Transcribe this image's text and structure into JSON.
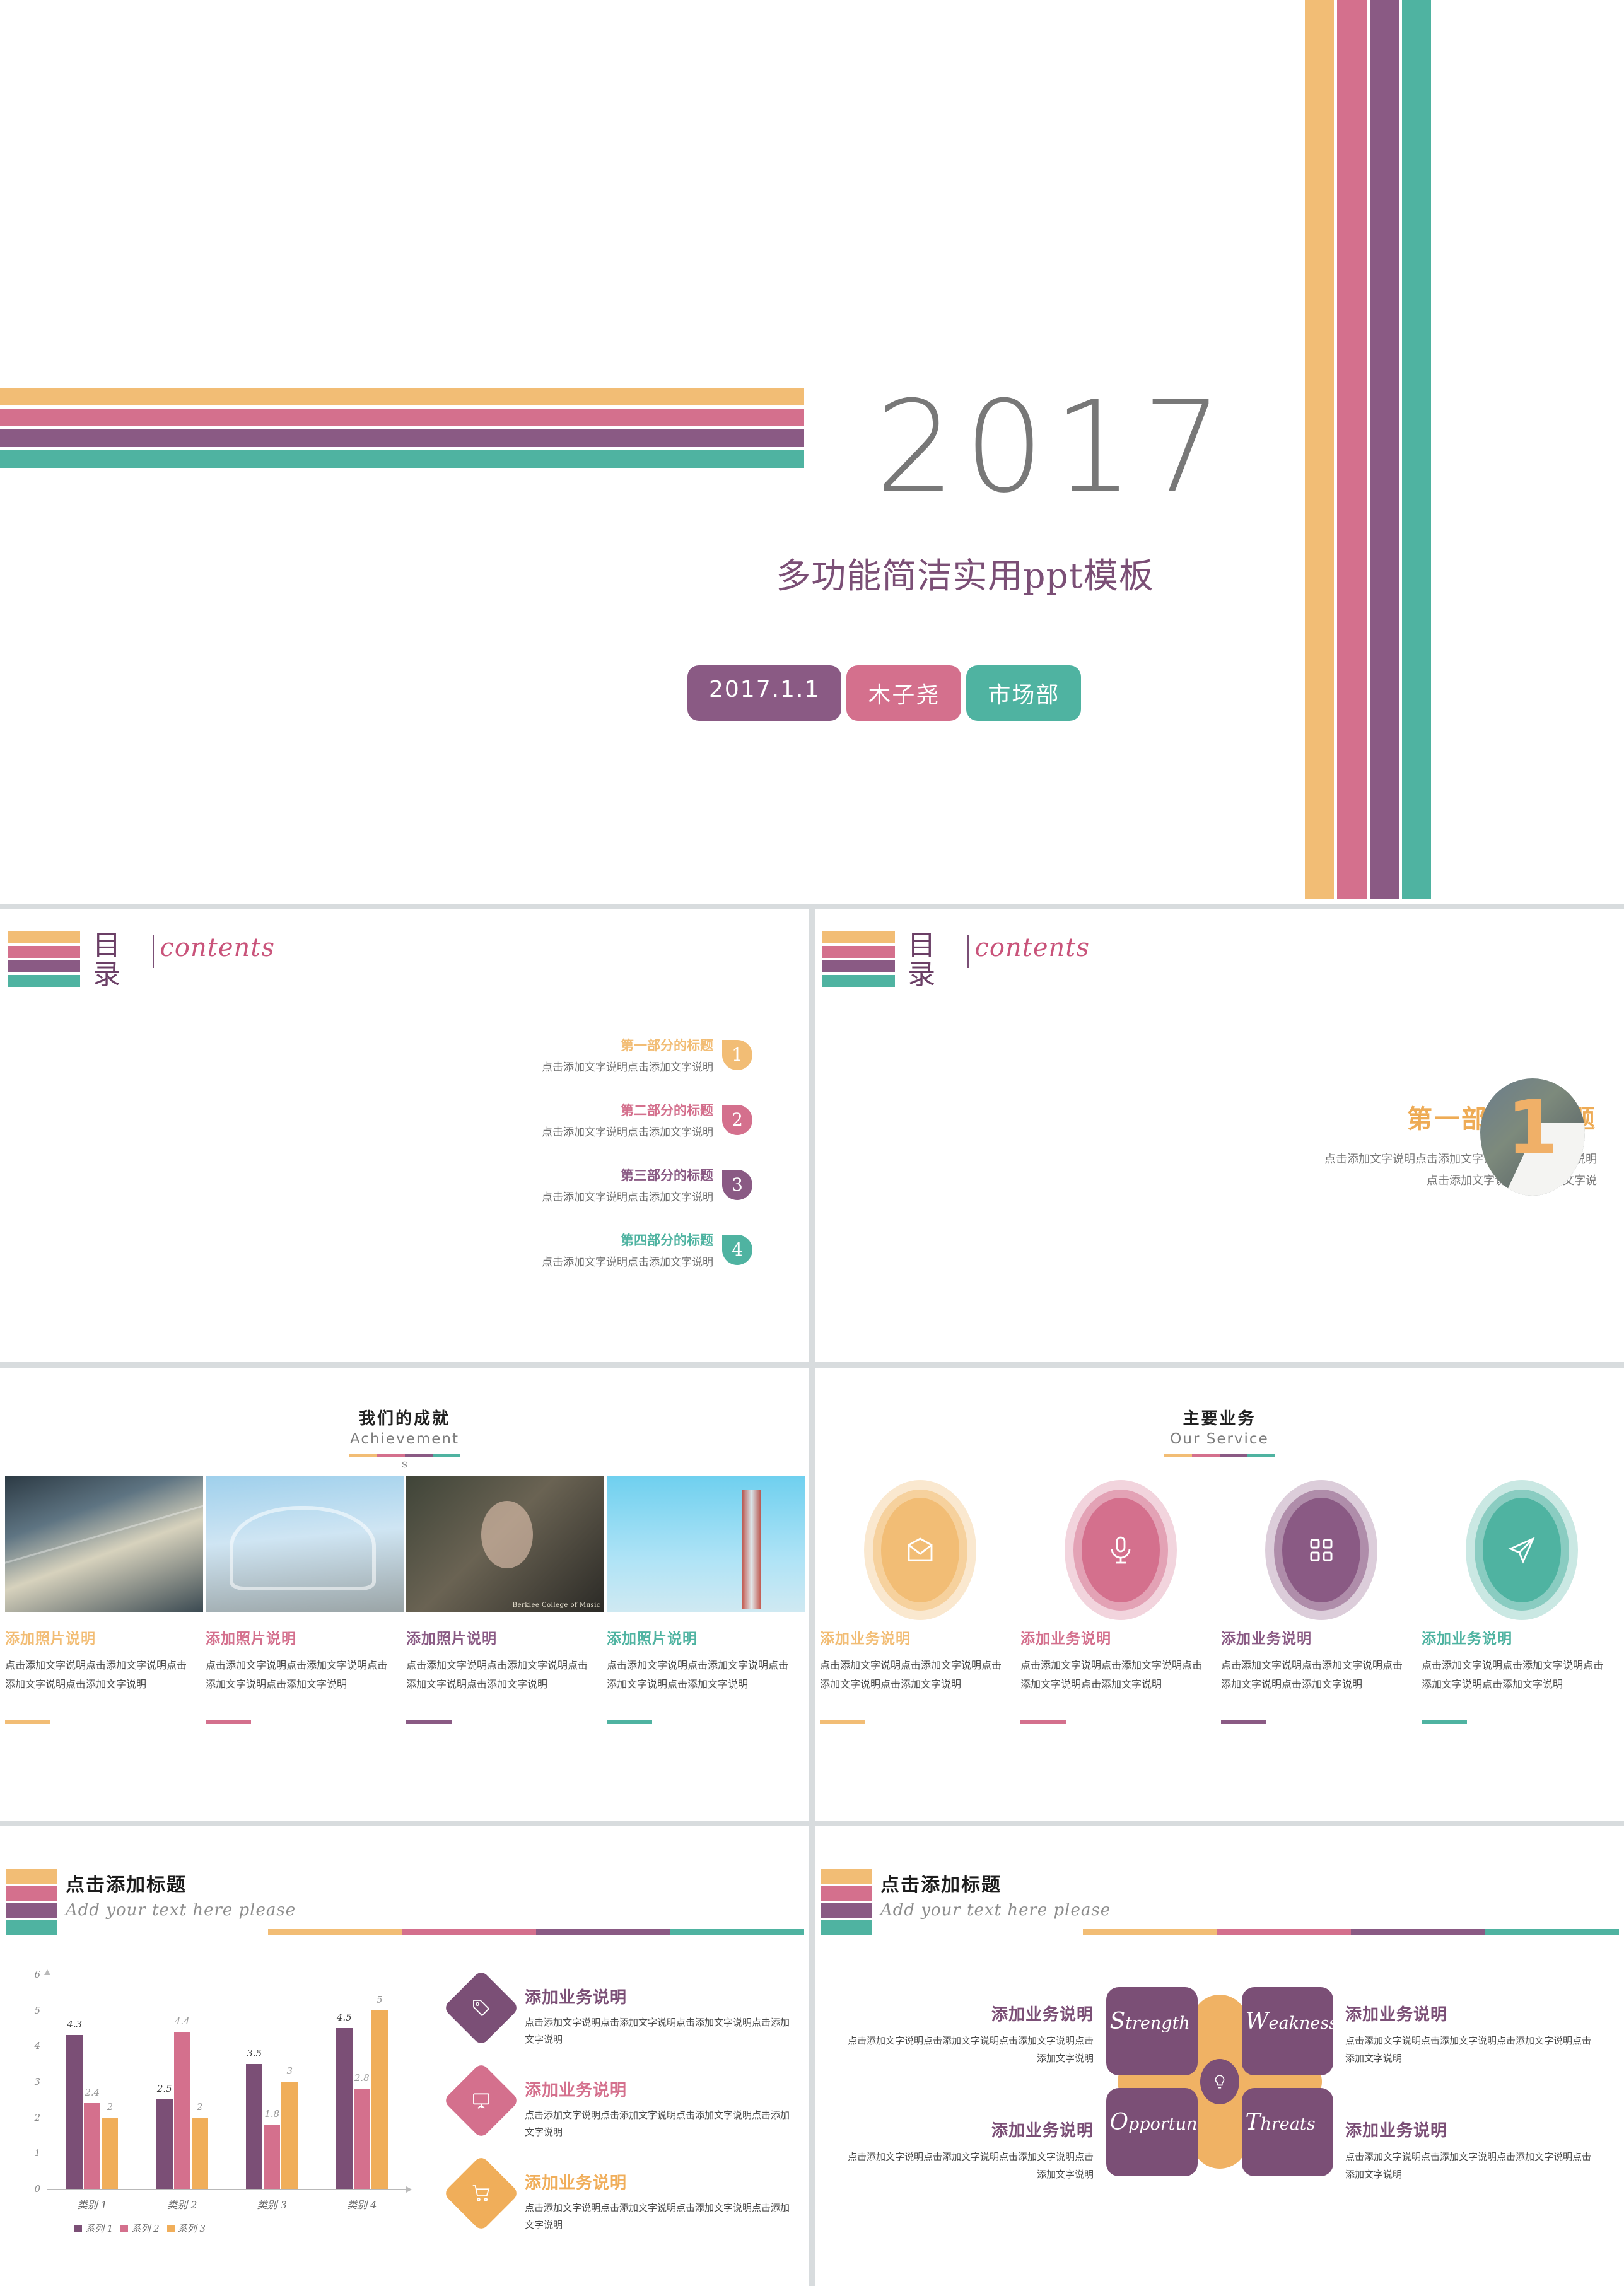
{
  "palette": {
    "orange": "#F2BD75",
    "pink": "#D4708D",
    "purple": "#8A5A84",
    "teal": "#4FB3A1",
    "orange_dark": "#EDA94E",
    "pink_dark": "#CC6384",
    "purple_dark": "#7B4F76",
    "teal_dark": "#45A694",
    "gap": "#D8DCDE"
  },
  "slide1": {
    "year": "2017",
    "title": "多功能简洁实用ppt模板",
    "tags": [
      {
        "label": "2017.1.1",
        "color": "#8A5A84"
      },
      {
        "label": "木子尧",
        "color": "#D4708D"
      },
      {
        "label": "市场部",
        "color": "#4FB3A1"
      }
    ]
  },
  "slide2": {
    "head_zh": "目录",
    "head_en": "contents",
    "items": [
      {
        "num": "1",
        "title": "第一部分的标题",
        "desc": "点击添加文字说明点击添加文字说明",
        "color": "#F2BD75"
      },
      {
        "num": "2",
        "title": "第二部分的标题",
        "desc": "点击添加文字说明点击添加文字说明",
        "color": "#D4708D"
      },
      {
        "num": "3",
        "title": "第三部分的标题",
        "desc": "点击添加文字说明点击添加文字说明",
        "color": "#8A5A84"
      },
      {
        "num": "4",
        "title": "第四部分的标题",
        "desc": "点击添加文字说明点击添加文字说明",
        "color": "#4FB3A1"
      }
    ]
  },
  "slide3": {
    "head_zh": "目录",
    "head_en": "contents",
    "section_title": "第一部分的标题",
    "section_line1": "点击添加文字说明点击添加文字说明点击添加文字说明",
    "section_line2": "点击添加文字说明点击添加文字说",
    "badge_number": "1"
  },
  "slide4": {
    "head_zh": "我们的成就",
    "head_en": "Achievement",
    "head_tail": "s",
    "photo_caption": "Berklee College of Music",
    "columns": [
      {
        "title": "添加照片说明",
        "body": "点击添加文字说明点击添加文字说明点击添加文字说明点击添加文字说明",
        "color": "#F2BD75"
      },
      {
        "title": "添加照片说明",
        "body": "点击添加文字说明点击添加文字说明点击添加文字说明点击添加文字说明",
        "color": "#D4708D"
      },
      {
        "title": "添加照片说明",
        "body": "点击添加文字说明点击添加文字说明点击添加文字说明点击添加文字说明",
        "color": "#8A5A84"
      },
      {
        "title": "添加照片说明",
        "body": "点击添加文字说明点击添加文字说明点击添加文字说明点击添加文字说明",
        "color": "#4FB3A1"
      }
    ]
  },
  "slide5": {
    "head_zh": "主要业务",
    "head_en": "Our Service",
    "columns": [
      {
        "icon": "envelope-icon",
        "title": "添加业务说明",
        "body": "点击添加文字说明点击添加文字说明点击添加文字说明点击添加文字说明",
        "color": "#F2BD75"
      },
      {
        "icon": "microphone-icon",
        "title": "添加业务说明",
        "body": "点击添加文字说明点击添加文字说明点击添加文字说明点击添加文字说明",
        "color": "#D4708D"
      },
      {
        "icon": "grid-icon",
        "title": "添加业务说明",
        "body": "点击添加文字说明点击添加文字说明点击添加文字说明点击添加文字说明",
        "color": "#8A5A84"
      },
      {
        "icon": "send-icon",
        "title": "添加业务说明",
        "body": "点击添加文字说明点击添加文字说明点击添加文字说明点击添加文字说明",
        "color": "#4FB3A1"
      }
    ]
  },
  "slide6": {
    "head_zh": "点击添加标题",
    "head_en": "Add your text here please",
    "items": [
      {
        "icon": "tag-icon",
        "title": "添加业务说明",
        "body": "点击添加文字说明点击添加文字说明点击添加文字说明点击添加文字说明",
        "color": "#7B4F76"
      },
      {
        "icon": "board-icon",
        "title": "添加业务说明",
        "body": "点击添加文字说明点击添加文字说明点击添加文字说明点击添加文字说明",
        "color": "#D4708D"
      },
      {
        "icon": "cart-icon",
        "title": "添加业务说明",
        "body": "点击添加文字说明点击添加文字说明点击添加文字说明点击添加文字说明",
        "color": "#F0AE5A"
      }
    ]
  },
  "slide7": {
    "head_zh": "点击添加标题",
    "head_en": "Add your text here please",
    "cells": [
      {
        "initial": "S",
        "rest": "trength"
      },
      {
        "initial": "W",
        "rest": "eakness"
      },
      {
        "initial": "O",
        "rest": "pportunity"
      },
      {
        "initial": "T",
        "rest": "hreats"
      }
    ],
    "sides": [
      {
        "title": "添加业务说明",
        "body": "点击添加文字说明点击添加文字说明点击添加文字说明点击添加文字说明"
      },
      {
        "title": "添加业务说明",
        "body": "点击添加文字说明点击添加文字说明点击添加文字说明点击添加文字说明"
      },
      {
        "title": "添加业务说明",
        "body": "点击添加文字说明点击添加文字说明点击添加文字说明点击添加文字说明"
      },
      {
        "title": "添加业务说明",
        "body": "点击添加文字说明点击添加文字说明点击添加文字说明点击添加文字说明"
      }
    ]
  },
  "chart_data": {
    "type": "bar",
    "title": "",
    "xlabel": "",
    "ylabel": "",
    "ylim": [
      0,
      6
    ],
    "yticks": [
      0,
      1,
      2,
      3,
      4,
      5,
      6
    ],
    "grid": false,
    "legend_position": "bottom",
    "categories": [
      "类别 1",
      "类别 2",
      "类别 3",
      "类别 4"
    ],
    "series": [
      {
        "name": "系列 1",
        "color": "#7B4F76",
        "values": [
          4.3,
          2.5,
          3.5,
          4.5
        ]
      },
      {
        "name": "系列 2",
        "color": "#D4708D",
        "values": [
          2.4,
          4.4,
          1.8,
          2.8
        ]
      },
      {
        "name": "系列 3",
        "color": "#F0AE5A",
        "values": [
          2,
          2,
          3,
          5
        ]
      }
    ],
    "value_labels": [
      [
        "4.3",
        "2.4",
        "2"
      ],
      [
        "2.5",
        "4.4",
        "2"
      ],
      [
        "3.5",
        "1.8",
        "3"
      ],
      [
        "4.5",
        "2.8",
        "5"
      ]
    ]
  }
}
